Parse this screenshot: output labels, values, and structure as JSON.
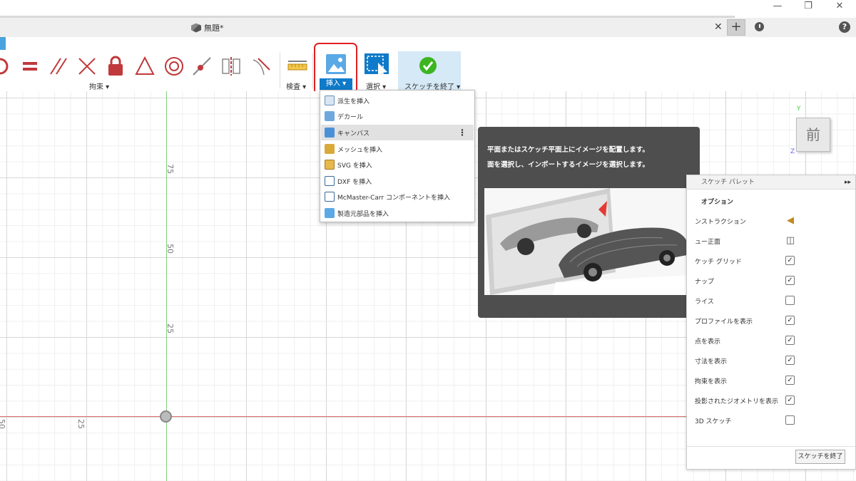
{
  "document": {
    "title": "無題*"
  },
  "toolbar": {
    "groups": {
      "constraints": "拘束 ▾",
      "inspect": "検査 ▾",
      "insert": "挿入 ▾",
      "select": "選択 ▾",
      "finish": "スケッチを終了 ▾"
    }
  },
  "insert_menu": {
    "items": [
      {
        "label": "派生を挿入",
        "icon": "derive-icon"
      },
      {
        "label": "デカール",
        "icon": "decal-icon"
      },
      {
        "label": "キャンバス",
        "icon": "canvas-icon"
      },
      {
        "label": "メッシュを挿入",
        "icon": "mesh-icon"
      },
      {
        "label": "SVG を挿入",
        "icon": "svg-icon"
      },
      {
        "label": "DXF を挿入",
        "icon": "dxf-icon"
      },
      {
        "label": "McMaster-Carr コンポーネントを挿入",
        "icon": "mcmaster-icon"
      },
      {
        "label": "製造元部品を挿入",
        "icon": "manufacturer-icon"
      }
    ]
  },
  "tooltip": {
    "line1": "平面またはスケッチ平面上にイメージを配置します。",
    "line2": "面を選択し、インポートするイメージを選択します。"
  },
  "canvas": {
    "labels_vertical": [
      "75",
      "50",
      "25"
    ],
    "labels_horizontal": [
      "50",
      "25"
    ],
    "viewcube": "前",
    "axis_y": "Y",
    "axis_z": "Z"
  },
  "palette": {
    "title": "スケッチ パレット",
    "section": "オプション",
    "options": [
      {
        "label": "ンストラクション",
        "control": "icon",
        "icon": "construction-icon"
      },
      {
        "label": "ュー正面",
        "control": "icon",
        "icon": "look-at-icon"
      },
      {
        "label": "ケッチ グリッド",
        "control": "check",
        "checked": true
      },
      {
        "label": "ナップ",
        "control": "check",
        "checked": true
      },
      {
        "label": "ライス",
        "control": "check",
        "checked": false
      },
      {
        "label": "プロファイルを表示",
        "control": "check",
        "checked": true
      },
      {
        "label": "点を表示",
        "control": "check",
        "checked": true
      },
      {
        "label": "寸法を表示",
        "control": "check",
        "checked": true
      },
      {
        "label": "拘束を表示",
        "control": "check",
        "checked": true
      },
      {
        "label": "投影されたジオメトリを表示",
        "control": "check",
        "checked": true
      },
      {
        "label": "3D スケッチ",
        "control": "check",
        "checked": false
      }
    ],
    "finish_button": "スケッチを終了"
  },
  "colors": {
    "accent": "#0e7ac9",
    "highlight": "#e02020",
    "constraint_red": "#c0393b",
    "finish_green": "#3cb521"
  }
}
